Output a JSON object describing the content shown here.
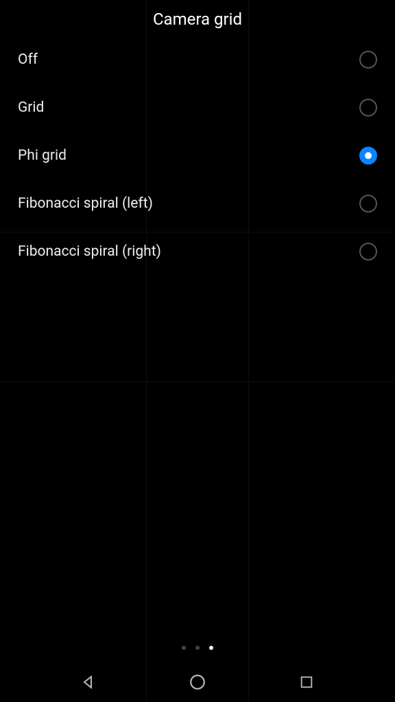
{
  "header": {
    "title": "Camera grid"
  },
  "options": [
    {
      "label": "Off",
      "selected": false
    },
    {
      "label": "Grid",
      "selected": false
    },
    {
      "label": "Phi grid",
      "selected": true
    },
    {
      "label": "Fibonacci spiral (left)",
      "selected": false
    },
    {
      "label": "Fibonacci spiral (right)",
      "selected": false
    }
  ],
  "pagination": {
    "count": 3,
    "active_index": 2
  }
}
